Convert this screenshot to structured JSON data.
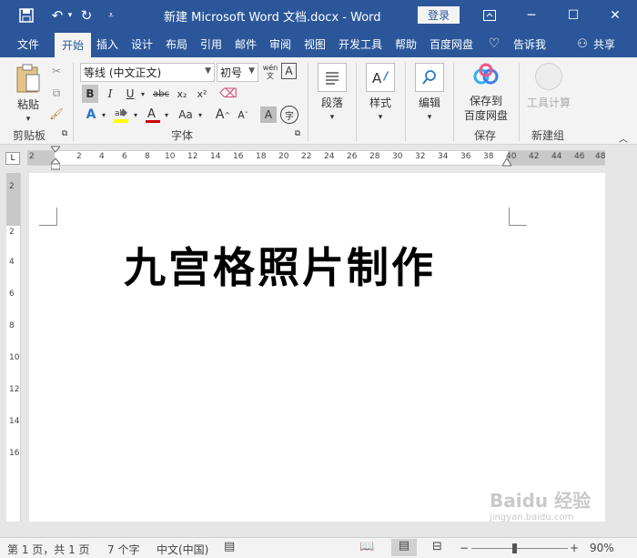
{
  "window": {
    "title": "新建 Microsoft Word 文档.docx  -  Word",
    "login_label": "登录",
    "quick_access": [
      "save-icon",
      "undo-icon",
      "redo-icon",
      "customize-icon"
    ],
    "controls": [
      "ribbon-display-icon",
      "minimize-icon",
      "maximize-icon",
      "close-icon"
    ]
  },
  "tabs": [
    "文件",
    "开始",
    "插入",
    "设计",
    "布局",
    "引用",
    "邮件",
    "审阅",
    "视图",
    "开发工具",
    "帮助",
    "百度网盘"
  ],
  "active_tab": "开始",
  "tell_me": "告诉我",
  "share": "共享",
  "ribbon": {
    "clipboard": {
      "label": "剪贴板",
      "paste": "粘贴"
    },
    "font": {
      "label": "字体",
      "font_name": "等线 (中文正文)",
      "font_size": "初号",
      "phonetic_label": "wén",
      "bold": "B",
      "italic": "I",
      "underline": "U",
      "strike": "abc",
      "subscript": "x₂",
      "superscript": "x²",
      "font_color_letter": "A",
      "case_label": "Aa",
      "grow": "A",
      "shrink": "A",
      "border_char": "A",
      "circle_char": "字"
    },
    "paragraph": {
      "label": "段落"
    },
    "styles": {
      "label": "样式"
    },
    "editing": {
      "label": "编辑"
    },
    "save_group": {
      "label": "保存",
      "button_line1": "保存到",
      "button_line2": "百度网盘"
    },
    "new_group": {
      "label": "新建组",
      "button": "工具计算"
    }
  },
  "ruler": {
    "ticks": [
      "2",
      "2",
      "4",
      "6",
      "8",
      "10",
      "12",
      "14",
      "16",
      "18",
      "20",
      "22",
      "24",
      "26",
      "28",
      "30",
      "32",
      "34",
      "36",
      "38",
      "40",
      "42",
      "44",
      "46",
      "48"
    ],
    "vticks": [
      "2",
      "2",
      "4",
      "6",
      "8",
      "10",
      "12",
      "14",
      "16"
    ]
  },
  "document": {
    "heading": "九宫格照片制作"
  },
  "status": {
    "page": "第 1 页，共 1 页",
    "words": "7 个字",
    "language": "中文(中国)",
    "zoom": "90%",
    "zoom_level": 0.9
  },
  "watermark": {
    "brand": "Baidu 经验",
    "url": "jingyan.baidu.com"
  }
}
